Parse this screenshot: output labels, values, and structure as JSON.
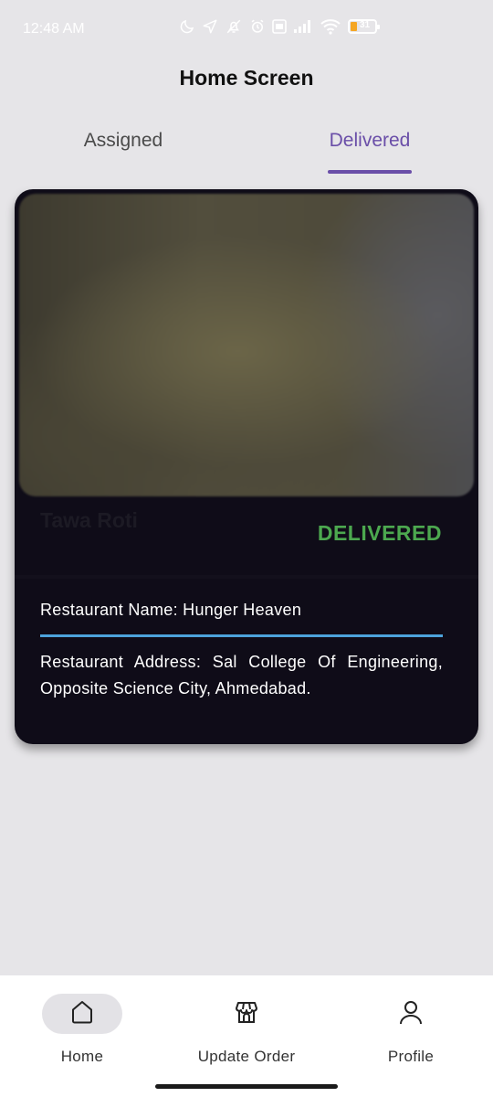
{
  "status_bar": {
    "time": "12:48 AM",
    "battery_level": "31",
    "icons": [
      "moon-icon",
      "location-arrow-icon",
      "bell-off-icon",
      "alarm-icon",
      "volte-icon",
      "signal-icon",
      "wifi-icon",
      "battery-icon"
    ]
  },
  "header": {
    "title": "Home Screen"
  },
  "tabs": [
    {
      "label": "Assigned",
      "selected": false
    },
    {
      "label": "Delivered",
      "selected": true
    }
  ],
  "order": {
    "dish_name": "Tawa Roti",
    "status": "DELIVERED",
    "restaurant_name": "Restaurant Name: Hunger Heaven",
    "restaurant_address": "Restaurant Address: Sal College Of Engineering, Opposite Science City, Ahmedabad."
  },
  "bottom_nav": {
    "items": [
      {
        "label": "Home",
        "icon": "home-icon",
        "selected": true
      },
      {
        "label": "Update Order",
        "icon": "store-icon",
        "selected": false
      },
      {
        "label": "Profile",
        "icon": "person-icon",
        "selected": false
      }
    ]
  },
  "colors": {
    "background": "#e6e5e8",
    "accent": "#6a4ea8",
    "card": "#0f0c18",
    "status_delivered": "#4ca84f",
    "divider": "#4da3dc"
  }
}
